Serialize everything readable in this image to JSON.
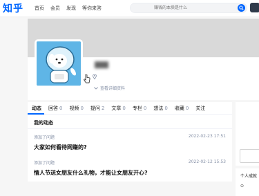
{
  "header": {
    "logo": "知乎",
    "nav": [
      "首页",
      "会员",
      "发现",
      "等你来答"
    ],
    "search_placeholder": "赚钱的本质是什么"
  },
  "profile": {
    "detail_link": "查看详细资料"
  },
  "tabs": [
    {
      "label": "动态",
      "count": ""
    },
    {
      "label": "回答",
      "count": "0"
    },
    {
      "label": "视频",
      "count": "0"
    },
    {
      "label": "提问",
      "count": "2"
    },
    {
      "label": "文章",
      "count": "0"
    },
    {
      "label": "专栏",
      "count": "0"
    },
    {
      "label": "想法",
      "count": "0"
    },
    {
      "label": "收藏",
      "count": "0"
    },
    {
      "label": "关注",
      "count": ""
    }
  ],
  "section_title": "我的动态",
  "activities": [
    {
      "action": "添加了问题",
      "time": "2022-02-23 17:51",
      "title": "大家如何看待网赚的?"
    },
    {
      "action": "添加了问题",
      "time": "2022-02-12 15:53",
      "title": "情人节送女朋友什么礼物，才能让女朋友开心?"
    }
  ],
  "sidebar": {
    "achievement_label": "个人成就",
    "row_icon": "⊙"
  },
  "colors": {
    "brand": "#0066ff",
    "meta": "#8590a6"
  }
}
